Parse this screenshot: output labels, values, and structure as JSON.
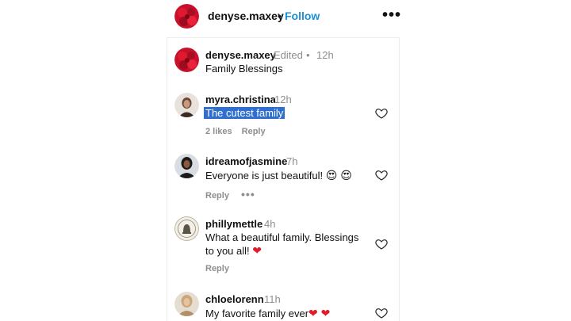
{
  "header": {
    "username": "denyse.maxey",
    "separator": "•",
    "follow_label": "Follow",
    "more_icon": "•••"
  },
  "caption": {
    "username": "denyse.maxey",
    "edited": "Edited",
    "separator": "•",
    "time": "12h",
    "text": "Family Blessings"
  },
  "comments": [
    {
      "username": "myra.christina",
      "time": "12h",
      "text": "The cutest family",
      "likes": "2 likes",
      "reply": "Reply"
    },
    {
      "username": "idreamofjasmine",
      "time": "7h",
      "text": "Everyone is just beautiful!",
      "emoji": "😍 😍",
      "reply": "Reply",
      "more_icon": "•••"
    },
    {
      "username": "phillymettle",
      "time": "4h",
      "text_line1": "What a beautiful family. Blessings",
      "text_line2": "to you all!",
      "heart_emoji": "❤",
      "reply": "Reply"
    },
    {
      "username": "chloelorenn",
      "time": "11h",
      "text": "My favorite family ever",
      "heart_emoji": "❤ ❤"
    }
  ],
  "colors": {
    "accent": "#1a8fd8",
    "highlight": "#2f6fd1",
    "muted": "#8e8e8e",
    "heart_red": "#e01b2c"
  }
}
